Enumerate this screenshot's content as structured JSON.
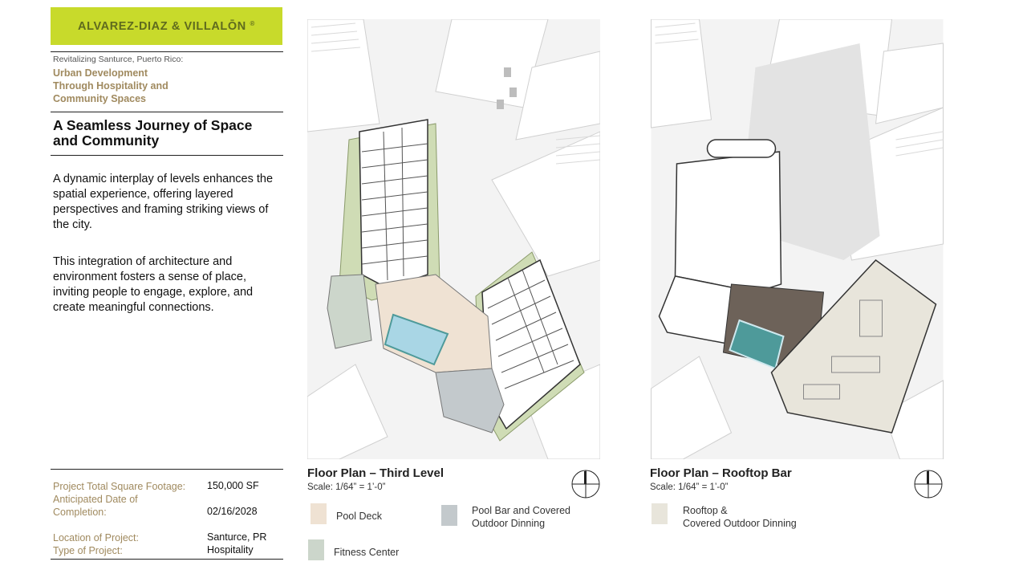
{
  "brand": {
    "name": "ALVAREZ-DIAZ & VILLALŌN",
    "mark": "®"
  },
  "subtitle": {
    "prefix": "Revitalizing Santurce, Puerto Rico:",
    "line1": "Urban Development",
    "line2": "Through Hospitality and",
    "line3": "Community Spaces"
  },
  "heading": {
    "line1": "A Seamless Journey of Space",
    "line2": "and Community"
  },
  "paragraphs": [
    "A dynamic interplay of levels enhances the spatial experience, offering layered perspectives and framing striking views of the city.",
    "This integration of architecture and environment fosters a sense of place, inviting people to engage, explore, and create meaningful connections."
  ],
  "project_info": {
    "sqft_label": "Project Total Square Footage:",
    "sqft_value": "150,000 SF",
    "date_label_1": "Anticipated Date of",
    "date_label_2": "Completion:",
    "date_value": "02/16/2028",
    "location_label": "Location of Project:",
    "location_value": "Santurce, PR",
    "type_label": "Type of Project:",
    "type_value": "Hospitality"
  },
  "plans": [
    {
      "title": "Floor Plan – Third Level",
      "scale": "Scale: 1/64” = 1’-0”",
      "legend": [
        {
          "label_1": "Pool Deck",
          "label_2": "",
          "color": "#efe2d3"
        },
        {
          "label_1": "Pool Bar and Covered",
          "label_2": "Outdoor Dinning",
          "color": "#c3c9cc"
        },
        {
          "label_1": "Fitness Center",
          "label_2": "",
          "color": "#ccd6cb"
        }
      ]
    },
    {
      "title": "Floor Plan – Rooftop Bar",
      "scale": "Scale: 1/64” = 1’-0”",
      "legend": [
        {
          "label_1": "Rooftop &",
          "label_2": "Covered Outdoor Dinning",
          "color": "#e8e5db"
        }
      ]
    }
  ],
  "colors": {
    "logo_bg": "#c8da2b",
    "accent_text": "#a08a5f",
    "lawn": "#cfdcb5",
    "pool": "#a9d6e5",
    "pool_dark": "#4e9a9a"
  }
}
